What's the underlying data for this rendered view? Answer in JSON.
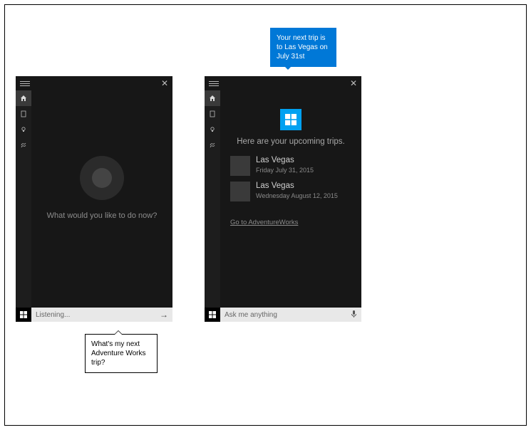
{
  "left_panel": {
    "prompt": "What would you like to do now?",
    "input_placeholder": "Listening...",
    "sidebar_icons": [
      "home-icon",
      "user-icon",
      "bulb-icon",
      "settings-icon"
    ]
  },
  "right_panel": {
    "heading": "Here are your upcoming trips.",
    "trips": [
      {
        "title": "Las Vegas",
        "date": "Friday July 31, 2015"
      },
      {
        "title": "Las Vegas",
        "date": "Wednesday August 12, 2015"
      }
    ],
    "goto_link": "Go to AdventureWorks",
    "input_placeholder": "Ask me anything"
  },
  "speech": {
    "cortana_reply": "Your next trip is to Las Vegas on July 31st",
    "user_query": "What's my next Adventure Works trip?"
  }
}
